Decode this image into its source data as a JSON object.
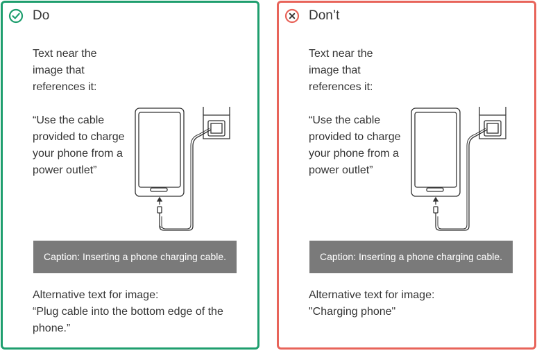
{
  "colors": {
    "do": "#1e9e6e",
    "dont": "#e8645a",
    "caption_bg": "#7a7a7a"
  },
  "panels": [
    {
      "title": "Do",
      "icon": "check-circle-icon",
      "intro": "Text near the\nimage that\nreferences it:",
      "quote": "“Use the cable\nprovided to charge\nyour phone from a\npower outlet”",
      "caption": "Caption: Inserting a phone charging cable.",
      "alt_text": "Alternative text for image:\n“Plug cable into the bottom edge of the\nphone.”"
    },
    {
      "title": "Don’t",
      "icon": "x-circle-icon",
      "intro": "Text near the\nimage that\nreferences it:",
      "quote": "“Use the cable\nprovided to charge\nyour phone from a\npower outlet”",
      "caption": "Caption: Inserting a phone charging cable.",
      "alt_text": "Alternative text for image:\n\"Charging phone\""
    }
  ]
}
